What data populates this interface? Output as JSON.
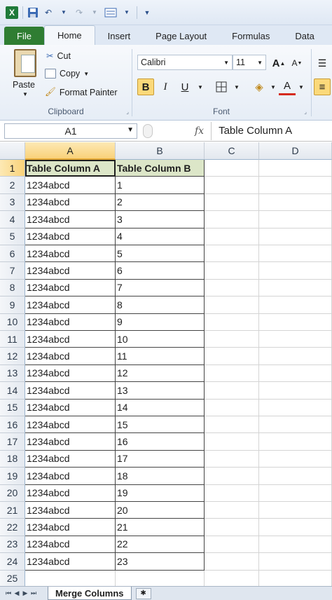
{
  "qat": {
    "app_icon": "X",
    "save_icon": "save-icon",
    "undo_icon": "undo-icon",
    "redo_icon": "redo-icon",
    "form_icon": "form-icon",
    "customize_icon": "customize-icon"
  },
  "tabs": [
    "File",
    "Home",
    "Insert",
    "Page Layout",
    "Formulas",
    "Data"
  ],
  "ribbon": {
    "clipboard": {
      "paste": "Paste",
      "cut": "Cut",
      "copy": "Copy",
      "format_painter": "Format Painter",
      "label": "Clipboard"
    },
    "font": {
      "name": "Calibri",
      "size": "11",
      "bold": "B",
      "italic": "I",
      "underline": "U",
      "font_color": "A",
      "label": "Font"
    }
  },
  "formula_bar": {
    "name_box": "A1",
    "fx": "fx",
    "value": "Table Column A"
  },
  "columns": [
    "A",
    "B",
    "C",
    "D"
  ],
  "selected_column": "A",
  "header_row": [
    "Table Column A",
    "Table Column B"
  ],
  "rows": [
    [
      "1234abcd",
      "1"
    ],
    [
      "1234abcd",
      "2"
    ],
    [
      "1234abcd",
      "3"
    ],
    [
      "1234abcd",
      "4"
    ],
    [
      "1234abcd",
      "5"
    ],
    [
      "1234abcd",
      "6"
    ],
    [
      "1234abcd",
      "7"
    ],
    [
      "1234abcd",
      "8"
    ],
    [
      "1234abcd",
      "9"
    ],
    [
      "1234abcd",
      "10"
    ],
    [
      "1234abcd",
      "11"
    ],
    [
      "1234abcd",
      "12"
    ],
    [
      "1234abcd",
      "13"
    ],
    [
      "1234abcd",
      "14"
    ],
    [
      "1234abcd",
      "15"
    ],
    [
      "1234abcd",
      "16"
    ],
    [
      "1234abcd",
      "17"
    ],
    [
      "1234abcd",
      "18"
    ],
    [
      "1234abcd",
      "19"
    ],
    [
      "1234abcd",
      "20"
    ],
    [
      "1234abcd",
      "21"
    ],
    [
      "1234abcd",
      "22"
    ],
    [
      "1234abcd",
      "23"
    ]
  ],
  "row_numbers": [
    "1",
    "2",
    "3",
    "4",
    "5",
    "6",
    "7",
    "8",
    "9",
    "10",
    "11",
    "12",
    "13",
    "14",
    "15",
    "16",
    "17",
    "18",
    "19",
    "20",
    "21",
    "22",
    "23",
    "24",
    "25"
  ],
  "sheet_tab": "Merge Columns",
  "colors": {
    "header_fill": "#dce6c8",
    "selected_header": "#f9d27a",
    "file_tab": "#2f7d32"
  }
}
